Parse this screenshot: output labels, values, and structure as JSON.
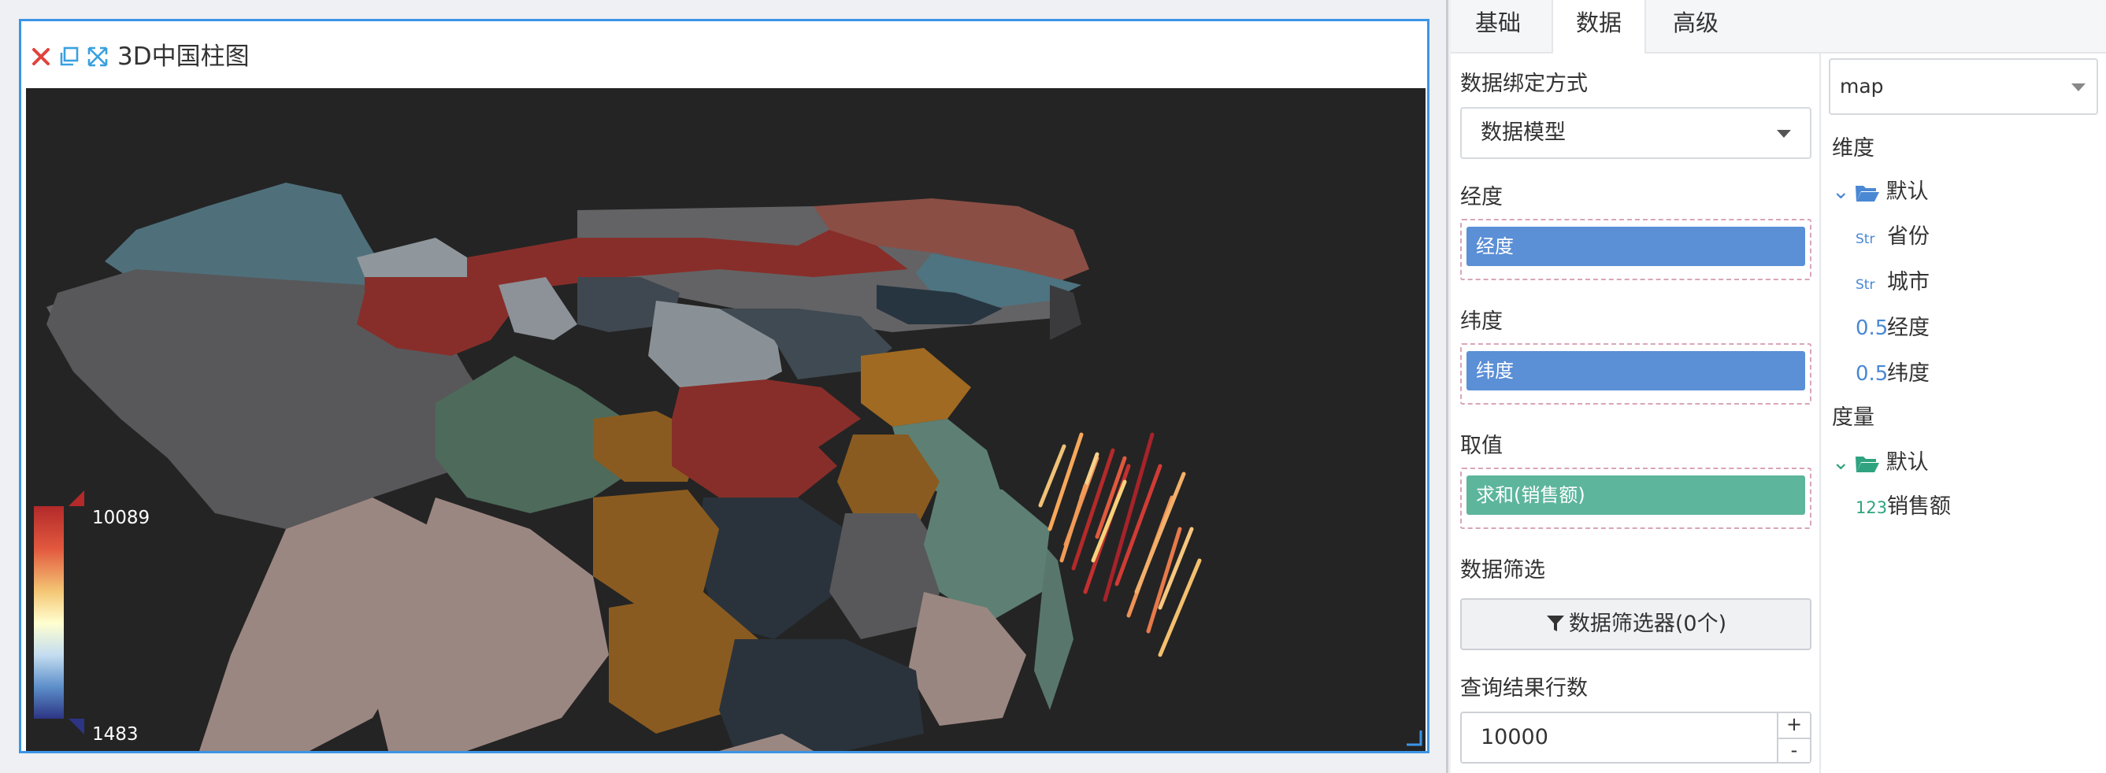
{
  "widget": {
    "title": "3D中国柱图",
    "icons": [
      "close-icon",
      "copy-icon",
      "expand-icon"
    ],
    "legend": {
      "max": "10089",
      "min": "1483"
    }
  },
  "tabs": [
    {
      "label": "基础",
      "active": false
    },
    {
      "label": "数据",
      "active": true
    },
    {
      "label": "高级",
      "active": false
    }
  ],
  "config": {
    "binding_label": "数据绑定方式",
    "binding_value": "数据模型",
    "lng_label": "经度",
    "lng_chip": "经度",
    "lat_label": "纬度",
    "lat_chip": "纬度",
    "value_label": "取值",
    "value_chip": "求和(销售额)",
    "filter_label": "数据筛选",
    "filter_button": "数据筛选器(0个)",
    "rows_label": "查询结果行数",
    "rows_value": "10000",
    "plus": "+",
    "minus": "-"
  },
  "model": {
    "dataset": "map",
    "dimensions_label": "维度",
    "dim_group": "默认",
    "dim_fields": [
      {
        "type": "Str",
        "name": "省份"
      },
      {
        "type": "Str",
        "name": "城市"
      },
      {
        "type": "0.5",
        "name": "经度"
      },
      {
        "type": "0.5",
        "name": "纬度"
      }
    ],
    "measures_label": "度量",
    "meas_group": "默认",
    "meas_fields": [
      {
        "type": "123",
        "name": "销售额"
      }
    ]
  },
  "colors": {
    "accent": "#3b95e6",
    "dim_chip": "#5b8fd6",
    "measure_chip": "#5db59c",
    "map_bg": "#242424"
  }
}
